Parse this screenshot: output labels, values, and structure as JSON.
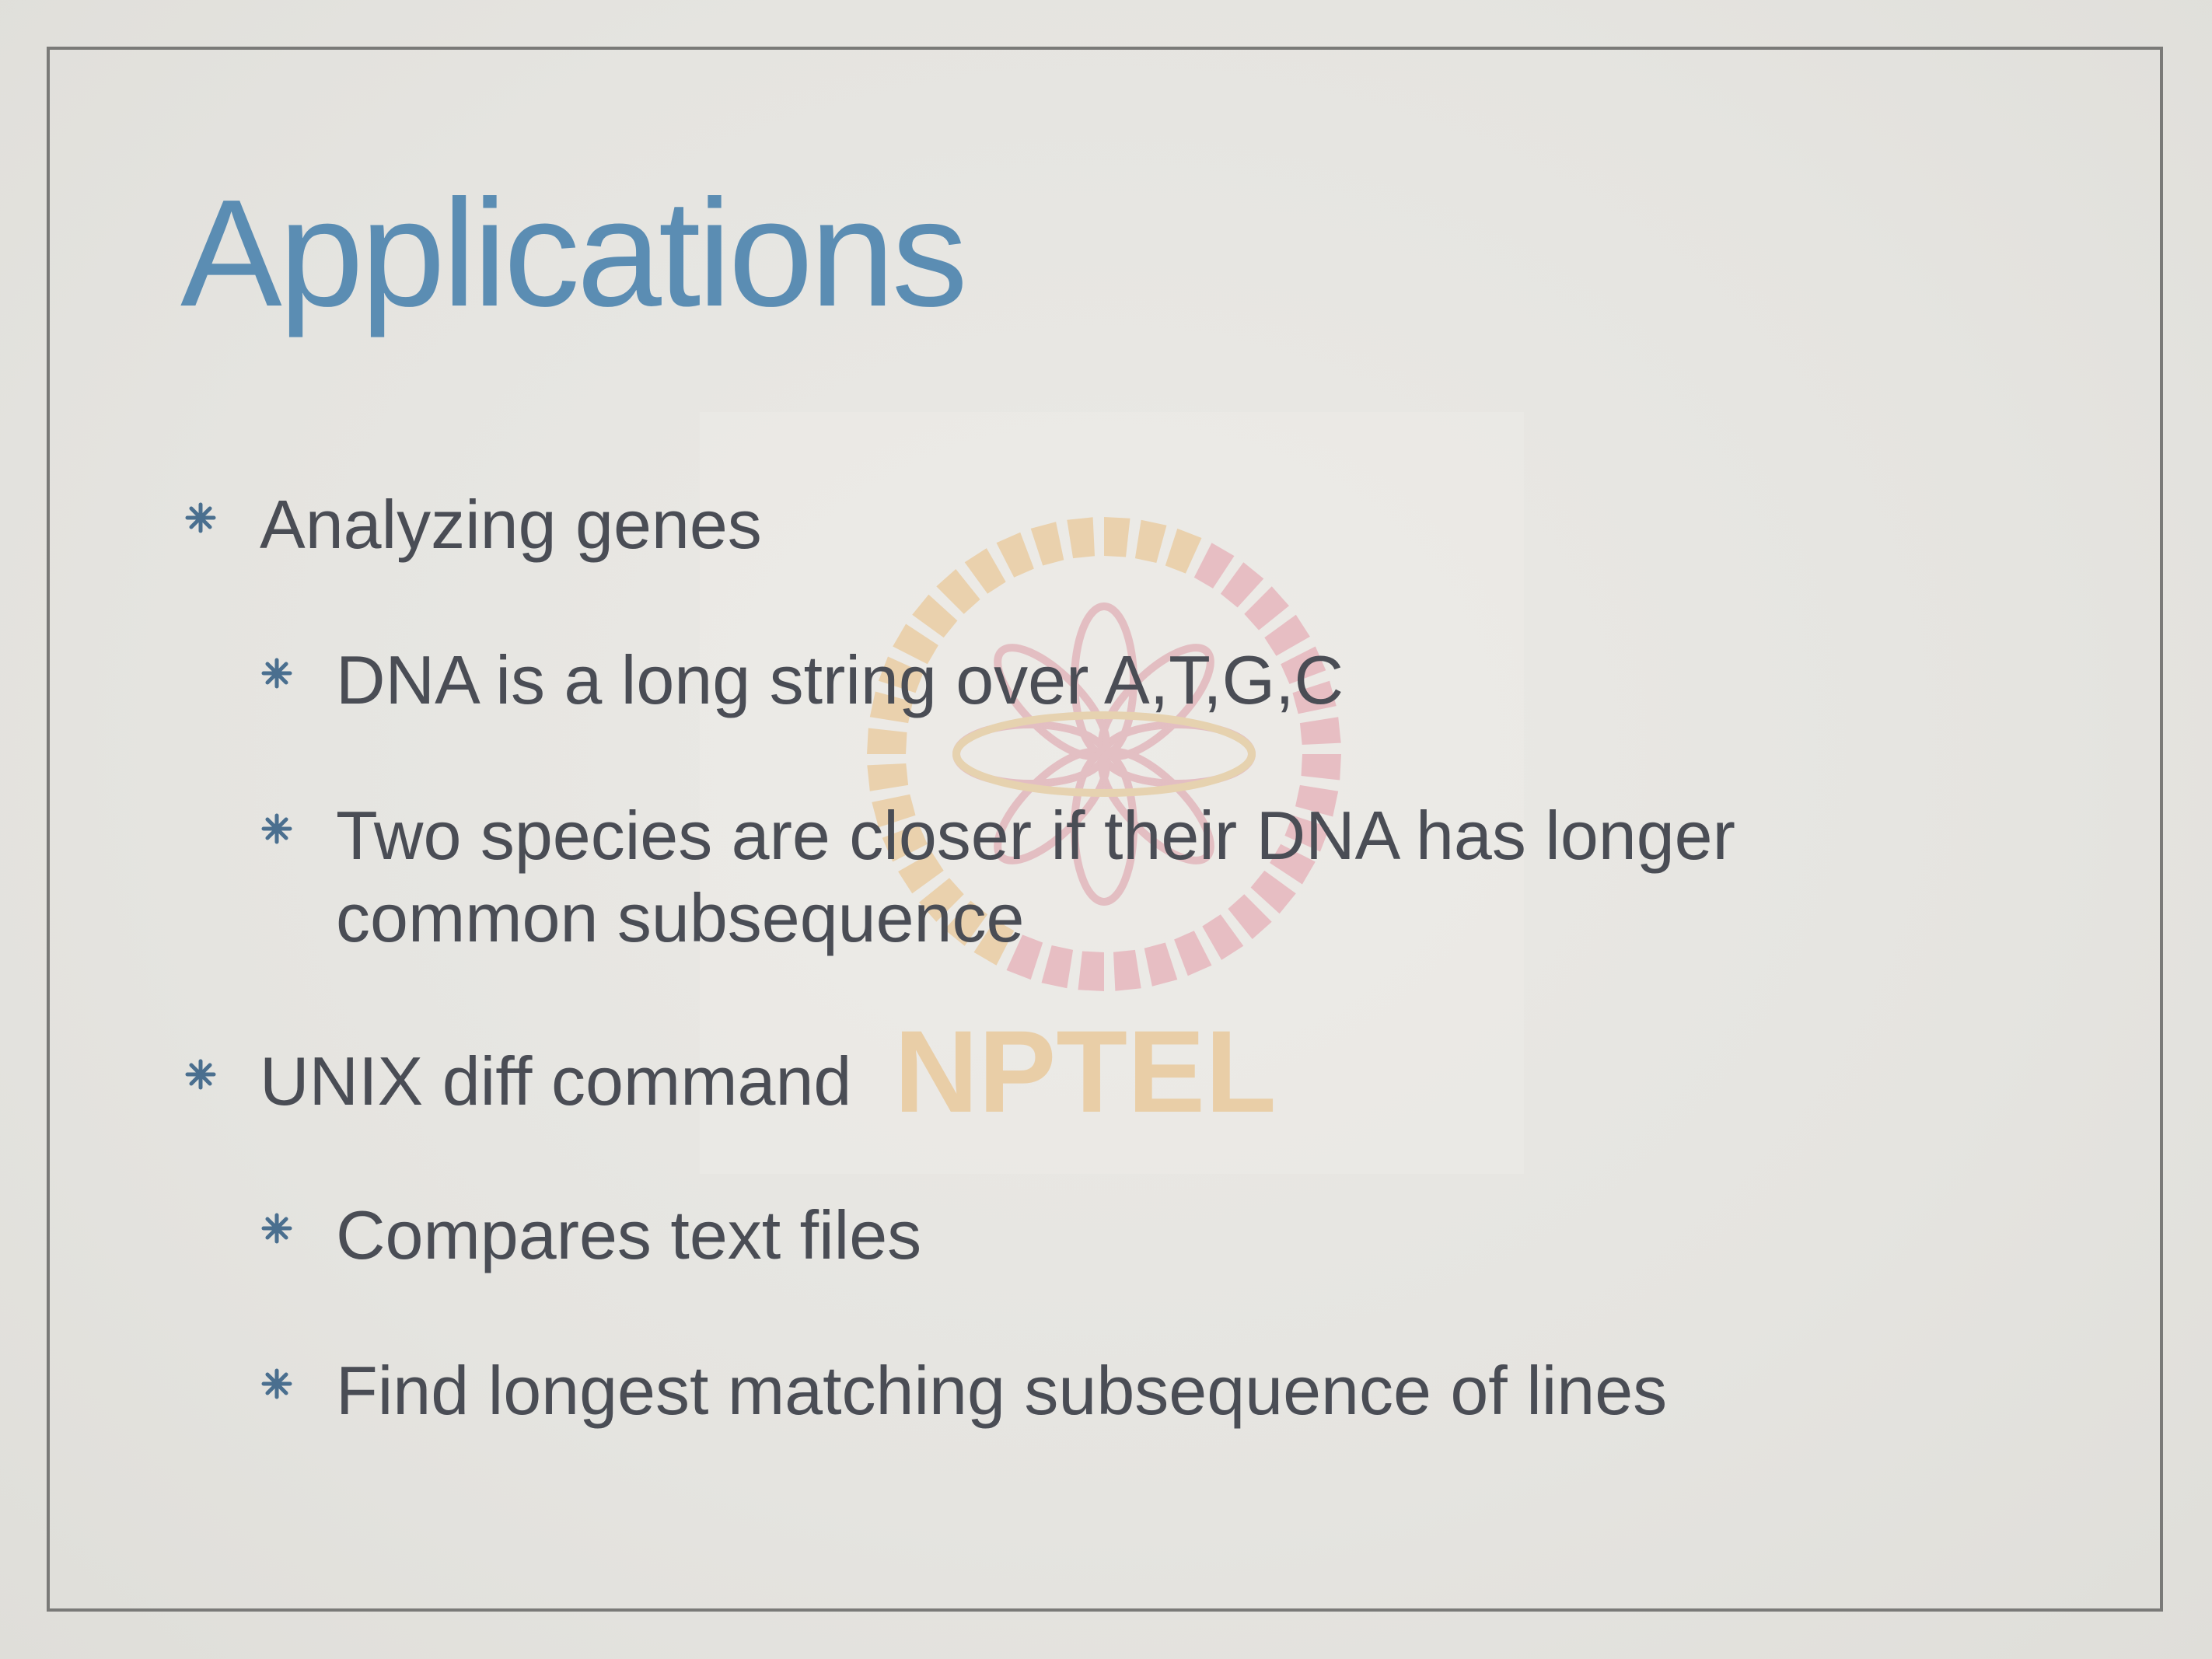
{
  "slide": {
    "title": "Applications",
    "title_color": "#5b8db3",
    "bullet_color": "#4a6f8f",
    "bullets": [
      {
        "level": 1,
        "text": "Analyzing genes"
      },
      {
        "level": 2,
        "text": "DNA is a long string over A,T,G,C"
      },
      {
        "level": 2,
        "lines": [
          "Two species are closer if their DNA has longer",
          "common subsequence"
        ]
      },
      {
        "level": 1,
        "text": "UNIX diff command"
      },
      {
        "level": 2,
        "text": "Compares text files"
      },
      {
        "level": 2,
        "text": "Find longest matching subsequence of lines"
      }
    ]
  },
  "watermark": {
    "text": "NPTEL",
    "icon": "nptel-logo-icon"
  }
}
